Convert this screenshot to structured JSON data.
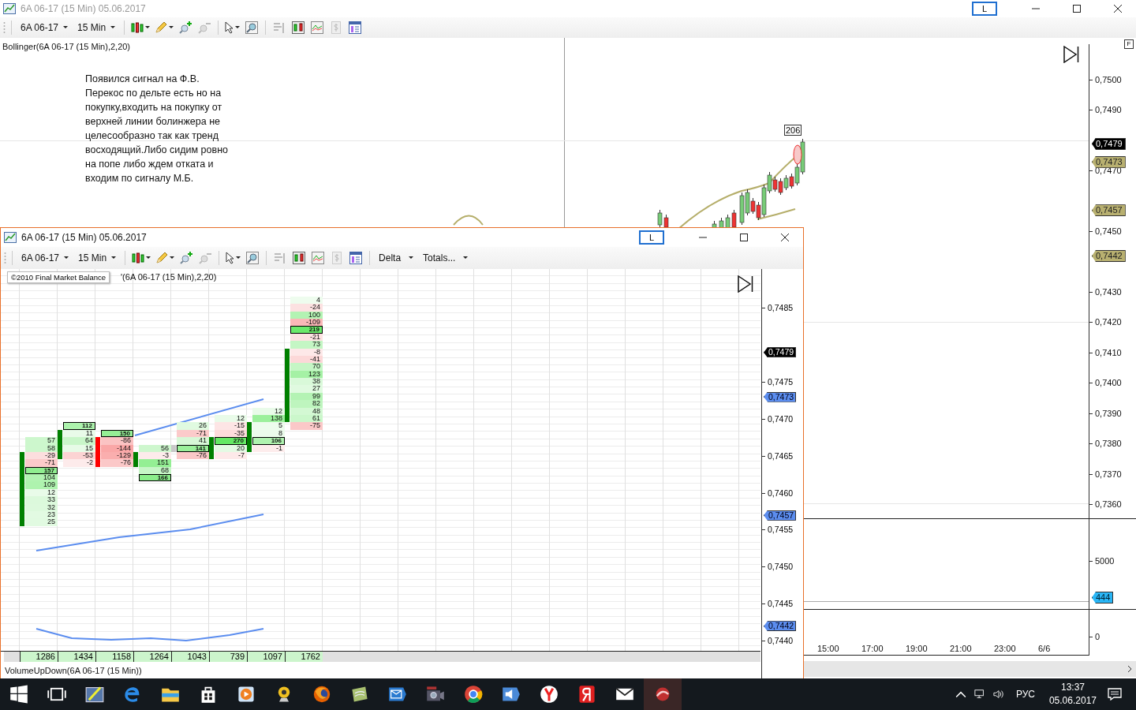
{
  "back_window": {
    "title": "6A 06-17 (15 Min)  05.06.2017",
    "active": false,
    "link_button": "L",
    "toolbar": {
      "instrument": "6A 06-17",
      "interval": "15 Min"
    },
    "indicator_label": "Bollinger(6A 06-17 (15 Min),2,20)",
    "note": "Появился сигнал на Ф.В.\nПерекос по дельте есть но на\nпокупку,входить на покупку от\nверхней линии болинжера не\nцелесообразно так как тренд\nвосходящий.Либо сидим ровно\nна попе либо ждем отката и\nвходим по сигналу М.Б.",
    "last_bar_label": "206",
    "panel_button": "F",
    "price_axis": [
      "0,7500",
      "0,7490",
      "0,7470",
      "0,7450",
      "0,7430",
      "0,7420",
      "0,7410",
      "0,7400",
      "0,7390",
      "0,7380",
      "0,7370",
      "0,7360"
    ],
    "price_markers": [
      {
        "text": "0,7479",
        "color": "#000000"
      },
      {
        "text": "0,7473",
        "color": "#b8b070"
      },
      {
        "text": "0,7457",
        "color": "#b8b070"
      },
      {
        "text": "0,7442",
        "color": "#b8b070"
      }
    ],
    "volume_axis": [
      "5000",
      "0"
    ],
    "volume_marker": "444",
    "time_axis": [
      "15:00",
      "17:00",
      "19:00",
      "21:00",
      "23:00",
      "6/6"
    ]
  },
  "front_window": {
    "title": "6A 06-17 (15 Min)  05.06.2017",
    "active": true,
    "link_button": "L",
    "toolbar": {
      "instrument": "6A 06-17",
      "interval": "15 Min",
      "menus": [
        "Delta",
        "Totals..."
      ]
    },
    "tooltip": "©2010 Final Market Balance",
    "indicator_label": "'(6A 06-17 (15 Min),2,20)",
    "columns": [
      {
        "color": "#008000",
        "cells": [
          {
            "value": "57",
            "boxed": false,
            "body": false
          },
          {
            "value": "58",
            "boxed": false,
            "body": false
          },
          {
            "value": "-29",
            "boxed": false,
            "body": true
          },
          {
            "value": "-71",
            "boxed": false,
            "body": true
          },
          {
            "value": "157",
            "boxed": true,
            "body": true
          },
          {
            "value": "104",
            "boxed": false,
            "body": true
          },
          {
            "value": "109",
            "boxed": false,
            "body": true
          },
          {
            "value": "12",
            "boxed": false,
            "body": true
          },
          {
            "value": "33",
            "boxed": false,
            "body": true
          },
          {
            "value": "32",
            "boxed": false,
            "body": true
          },
          {
            "value": "23",
            "boxed": false,
            "body": true
          },
          {
            "value": "25",
            "boxed": false,
            "body": true
          }
        ]
      },
      {
        "color": "#008000",
        "cells": [
          {
            "value": "112",
            "boxed": true,
            "body": false
          },
          {
            "value": "11",
            "boxed": false,
            "body": true
          },
          {
            "value": "64",
            "boxed": false,
            "body": true
          },
          {
            "value": "15",
            "boxed": false,
            "body": true
          },
          {
            "value": "-53",
            "boxed": false,
            "body": true
          },
          {
            "value": "-2",
            "boxed": false,
            "body": false
          }
        ]
      },
      {
        "color": "#ff0000",
        "cells": [
          {
            "value": "150",
            "boxed": true,
            "body": false
          },
          {
            "value": "-86",
            "boxed": false,
            "body": true
          },
          {
            "value": "-144",
            "boxed": false,
            "body": true
          },
          {
            "value": "-129",
            "boxed": false,
            "body": true
          },
          {
            "value": "-76",
            "boxed": false,
            "body": true
          }
        ]
      },
      {
        "color": "#008000",
        "cells": [
          {
            "value": "56",
            "boxed": false,
            "body": false
          },
          {
            "value": "-3",
            "boxed": false,
            "body": true
          },
          {
            "value": "151",
            "boxed": false,
            "body": true
          },
          {
            "value": "68",
            "boxed": false,
            "body": false
          },
          {
            "value": "166",
            "boxed": true,
            "body": false
          }
        ]
      },
      {
        "color": "#c8c8c8",
        "cells": [
          {
            "value": "26",
            "boxed": false,
            "body": false
          },
          {
            "value": "-71",
            "boxed": false,
            "body": false
          },
          {
            "value": "41",
            "boxed": false,
            "body": false
          },
          {
            "value": "141",
            "boxed": true,
            "body": true
          },
          {
            "value": "-76",
            "boxed": false,
            "body": false
          }
        ]
      },
      {
        "color": "#008000",
        "cells": [
          {
            "value": "12",
            "boxed": false,
            "body": false
          },
          {
            "value": "-15",
            "boxed": false,
            "body": false
          },
          {
            "value": "-35",
            "boxed": false,
            "body": false
          },
          {
            "value": "270",
            "boxed": true,
            "body": true
          },
          {
            "value": "20",
            "boxed": false,
            "body": true
          },
          {
            "value": "-7",
            "boxed": false,
            "body": true
          }
        ]
      },
      {
        "color": "#008000",
        "cells": [
          {
            "value": "12",
            "boxed": false,
            "body": false
          },
          {
            "value": "138",
            "boxed": false,
            "body": false
          },
          {
            "value": "5",
            "boxed": false,
            "body": true
          },
          {
            "value": "8",
            "boxed": false,
            "body": true
          },
          {
            "value": "106",
            "boxed": true,
            "body": true
          },
          {
            "value": "-1",
            "boxed": false,
            "body": true
          }
        ]
      },
      {
        "color": "#008000",
        "cells": [
          {
            "value": "4",
            "boxed": false,
            "body": false
          },
          {
            "value": "-24",
            "boxed": false,
            "body": false
          },
          {
            "value": "100",
            "boxed": false,
            "body": false
          },
          {
            "value": "-109",
            "boxed": false,
            "body": false
          },
          {
            "value": "219",
            "boxed": true,
            "body": false
          },
          {
            "value": "-21",
            "boxed": false,
            "body": false
          },
          {
            "value": "73",
            "boxed": false,
            "body": false
          },
          {
            "value": "-8",
            "boxed": false,
            "body": true
          },
          {
            "value": "-41",
            "boxed": false,
            "body": true
          },
          {
            "value": "70",
            "boxed": false,
            "body": true
          },
          {
            "value": "123",
            "boxed": false,
            "body": true
          },
          {
            "value": "38",
            "boxed": false,
            "body": true
          },
          {
            "value": "27",
            "boxed": false,
            "body": true
          },
          {
            "value": "99",
            "boxed": false,
            "body": true
          },
          {
            "value": "82",
            "boxed": false,
            "body": true
          },
          {
            "value": "48",
            "boxed": false,
            "body": true
          },
          {
            "value": "61",
            "boxed": false,
            "body": true
          },
          {
            "value": "-75",
            "boxed": false,
            "body": false
          }
        ]
      }
    ],
    "totals": [
      "1286",
      "1434",
      "1158",
      "1264",
      "1043",
      "739",
      "1097",
      "1762"
    ],
    "price_axis": [
      "0,7485",
      "0,7475",
      "0,7470",
      "0,7465",
      "0,7460",
      "0,7455",
      "0,7450",
      "0,7445",
      "0,7440"
    ],
    "price_markers": [
      {
        "text": "0,7479",
        "color": "#000000"
      },
      {
        "text": "0,7473",
        "color": "#5b8def"
      },
      {
        "text": "0,7457",
        "color": "#5b8def"
      },
      {
        "text": "0,7442",
        "color": "#5b8def"
      }
    ],
    "lower_indicator_label": "VolumeUpDown(6A 06-17 (15 Min))"
  },
  "taskbar": {
    "language": "РУС",
    "time": "13:37",
    "date": "05.06.2017"
  }
}
